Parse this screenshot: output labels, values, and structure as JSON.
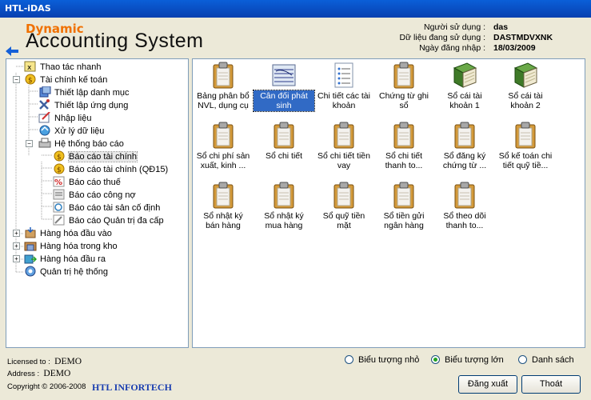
{
  "window": {
    "title": "HTL-iDAS"
  },
  "brand": {
    "line1": "Dynamic",
    "line2": "Accounting System"
  },
  "session": {
    "user_label": "Người sử dụng :",
    "user_value": "das",
    "data_label": "Dữ liệu đang sử dụng :",
    "data_value": "DASTMDVXNK",
    "date_label": "Ngày đăng nhập :",
    "date_value": "18/03/2009"
  },
  "tree": {
    "items": [
      {
        "label": "Thao tác nhanh",
        "icon": "quick-action-icon"
      },
      {
        "label": "Tài chính kế toán",
        "icon": "finance-icon"
      },
      {
        "label": "Thiết lập danh mục",
        "icon": "catalog-settings-icon"
      },
      {
        "label": "Thiết lập ứng dụng",
        "icon": "app-settings-icon"
      },
      {
        "label": "Nhập liệu",
        "icon": "data-entry-icon"
      },
      {
        "label": "Xử lý dữ liệu",
        "icon": "data-processing-icon"
      },
      {
        "label": "Hệ thống báo cáo",
        "icon": "report-system-icon"
      },
      {
        "label": "Báo cáo tài chính",
        "icon": "financial-report-icon"
      },
      {
        "label": "Báo cáo tài chính (QĐ15)",
        "icon": "financial-report-qd15-icon"
      },
      {
        "label": "Báo cáo thuế",
        "icon": "tax-report-icon"
      },
      {
        "label": "Báo cáo công nợ",
        "icon": "debt-report-icon"
      },
      {
        "label": "Báo cáo tài sản cố định",
        "icon": "fixed-asset-report-icon"
      },
      {
        "label": "Báo cáo Quản trị đa cấp",
        "icon": "management-report-icon"
      },
      {
        "label": "Hàng hóa đầu vào",
        "icon": "goods-in-icon"
      },
      {
        "label": "Hàng hóa trong kho",
        "icon": "warehouse-icon"
      },
      {
        "label": "Hàng hóa đầu ra",
        "icon": "goods-out-icon"
      },
      {
        "label": "Quản trị hệ thống",
        "icon": "system-admin-icon"
      }
    ]
  },
  "reports": [
    {
      "line1": "Bảng phân bổ",
      "line2": "NVL, dụng cụ",
      "icon": "clipboard-icon"
    },
    {
      "line1": "Cân đối phát",
      "line2": "sinh",
      "icon": "ledger-icon"
    },
    {
      "line1": "Chi tiết các tài",
      "line2": "khoản",
      "icon": "list-document-icon"
    },
    {
      "line1": "Chứng từ ghi",
      "line2": "sổ",
      "icon": "clipboard-icon"
    },
    {
      "line1": "Sổ cái tài",
      "line2": "khoản 1",
      "icon": "green-book-icon"
    },
    {
      "line1": "Sổ cái tài",
      "line2": "khoản 2",
      "icon": "green-book-icon"
    },
    {
      "line1": "Sổ chi phí sản",
      "line2": "xuất, kinh ...",
      "icon": "clipboard-icon"
    },
    {
      "line1": "Sổ chi tiết",
      "line2": "",
      "icon": "clipboard-icon"
    },
    {
      "line1": "Sổ chi tiết tiền",
      "line2": "vay",
      "icon": "clipboard-icon"
    },
    {
      "line1": "Sổ chi tiết",
      "line2": "thanh to...",
      "icon": "clipboard-icon"
    },
    {
      "line1": "Sổ đăng ký",
      "line2": "chứng từ ...",
      "icon": "clipboard-icon"
    },
    {
      "line1": "Sổ kế toán chi",
      "line2": "tiết quỹ tiề...",
      "icon": "clipboard-icon"
    },
    {
      "line1": "Sổ nhật ký",
      "line2": "bán hàng",
      "icon": "clipboard-icon"
    },
    {
      "line1": "Sổ nhật ký",
      "line2": "mua hàng",
      "icon": "clipboard-icon"
    },
    {
      "line1": "Sổ quỹ tiền",
      "line2": "mặt",
      "icon": "clipboard-icon"
    },
    {
      "line1": "Sổ tiền gửi",
      "line2": "ngân hàng",
      "icon": "clipboard-icon"
    },
    {
      "line1": "Sổ theo dõi",
      "line2": "thanh to...",
      "icon": "clipboard-icon"
    }
  ],
  "view_options": {
    "small": "Biểu tượng nhỏ",
    "large": "Biểu tượng lớn",
    "list": "Danh sách",
    "selected": "large"
  },
  "license": {
    "licensed_label": "Licensed to :",
    "licensed_value": "DEMO",
    "address_label": "Address :",
    "address_value": "DEMO",
    "copyright": "Copyright © 2006-2008",
    "company": "HTL INFORTECH"
  },
  "buttons": {
    "logout": "Đăng xuất",
    "exit": "Thoát"
  },
  "colors": {
    "titlebar": "#0a5fd8",
    "brand_orange": "#f07000",
    "selection": "#316ac5",
    "company": "#1a3eb0"
  }
}
